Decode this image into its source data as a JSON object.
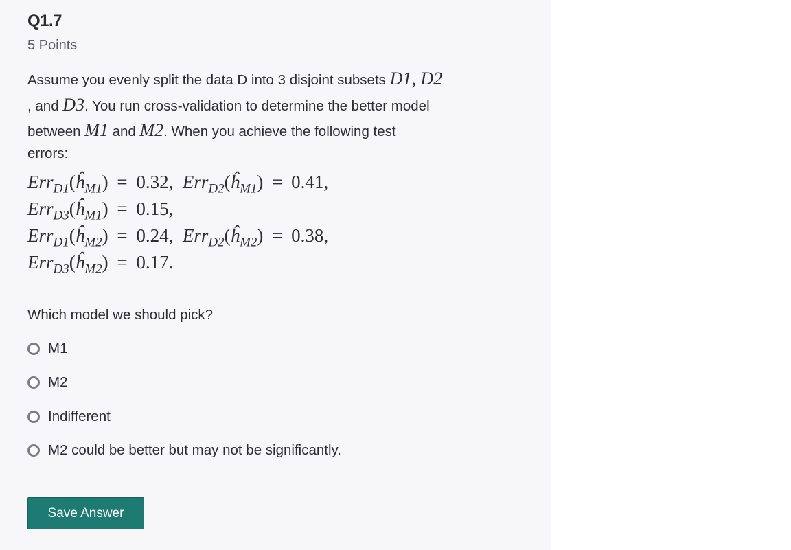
{
  "question": {
    "title": "Q1.7",
    "points": "5 Points",
    "prompt_lines": [
      [
        "Assume you evenly split the data D into 3 disjoint subsets ",
        "D1, D2"
      ],
      [
        ", and ",
        "D3",
        ". You run cross-validation to determine the better model"
      ],
      [
        "between ",
        "M1",
        " and ",
        "M2",
        ". When you achieve the following test"
      ],
      [
        "errors:"
      ]
    ],
    "equations": [
      "Err_{D1}(ĥ_{M1}) = 0.32,  Err_{D2}(ĥ_{M1}) = 0.41,",
      "Err_{D3}(ĥ_{M1}) = 0.15,",
      "Err_{D1}(ĥ_{M2}) = 0.24,  Err_{D2}(ĥ_{M2}) = 0.38,",
      "Err_{D3}(ĥ_{M2}) = 0.17."
    ],
    "ask": "Which model we should pick?"
  },
  "options": [
    {
      "label": "M1",
      "selected": false
    },
    {
      "label": "M2",
      "selected": false
    },
    {
      "label": "Indifferent",
      "selected": false
    },
    {
      "label": "M2 could be better but may not be significantly.",
      "selected": false
    }
  ],
  "save_button": {
    "label": "Save Answer"
  },
  "colors": {
    "accent": "#1e7b73",
    "panel": "#f7f7f9",
    "text": "#2b2d33"
  }
}
